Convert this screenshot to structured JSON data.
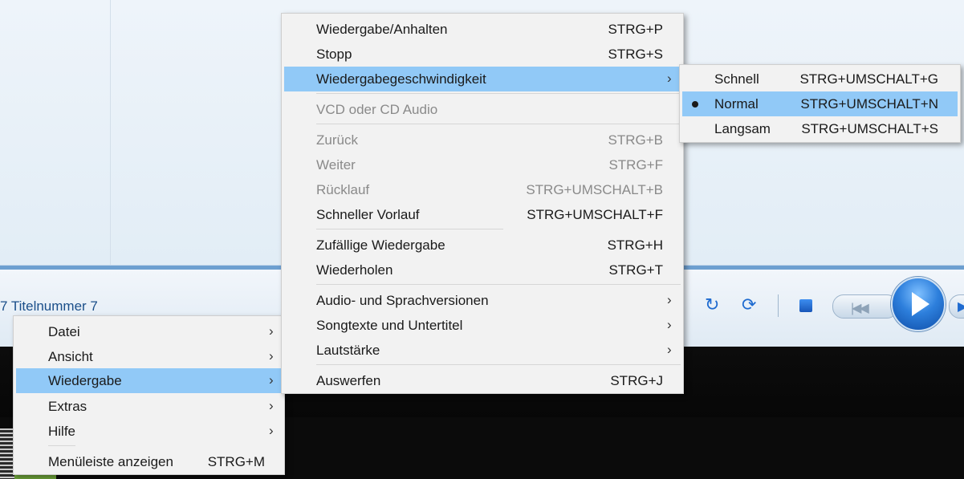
{
  "status": {
    "title": "7 Titelnummer 7"
  },
  "icons": {
    "repeat": "↻",
    "refresh": "⟳",
    "prev": "|◀◀",
    "next": "▶"
  },
  "main_menu": {
    "items": [
      {
        "label": "Datei",
        "arrow": "›"
      },
      {
        "label": "Ansicht",
        "arrow": "›"
      },
      {
        "label": "Wiedergabe",
        "arrow": "›"
      },
      {
        "label": "Extras",
        "arrow": "›"
      },
      {
        "label": "Hilfe",
        "arrow": "›"
      },
      {
        "label": "Menüleiste anzeigen",
        "shortcut": "STRG+M"
      }
    ]
  },
  "playback_menu": {
    "items": [
      {
        "label": "Wiedergabe/Anhalten",
        "shortcut": "STRG+P"
      },
      {
        "label": "Stopp",
        "shortcut": "STRG+S"
      },
      {
        "label": "Wiedergabegeschwindigkeit",
        "arrow": "›"
      },
      {
        "label": "VCD  oder CD  Audio"
      },
      {
        "label": "Zurück",
        "shortcut": "STRG+B"
      },
      {
        "label": "Weiter",
        "shortcut": "STRG+F"
      },
      {
        "label": "Rücklauf",
        "shortcut": "STRG+UMSCHALT+B"
      },
      {
        "label": "Schneller Vorlauf",
        "shortcut": "STRG+UMSCHALT+F"
      },
      {
        "label": "Zufällige Wiedergabe",
        "shortcut": "STRG+H"
      },
      {
        "label": "Wiederholen",
        "shortcut": "STRG+T"
      },
      {
        "label": "Audio- und Sprachversionen",
        "arrow": "›"
      },
      {
        "label": "Songtexte und Untertitel",
        "arrow": "›"
      },
      {
        "label": "Lautstärke",
        "arrow": "›"
      },
      {
        "label": "Auswerfen",
        "shortcut": "STRG+J"
      }
    ]
  },
  "speed_menu": {
    "items": [
      {
        "label": "Schnell",
        "shortcut": "STRG+UMSCHALT+G"
      },
      {
        "label": "Normal",
        "shortcut": "STRG+UMSCHALT+N"
      },
      {
        "label": "Langsam",
        "shortcut": "STRG+UMSCHALT+S"
      }
    ]
  },
  "colors": {
    "highlight": "#91c9f7",
    "menu_bg": "#f2f2f2",
    "disabled_text": "#8a8a8a",
    "accent": "#1f6bd0"
  }
}
